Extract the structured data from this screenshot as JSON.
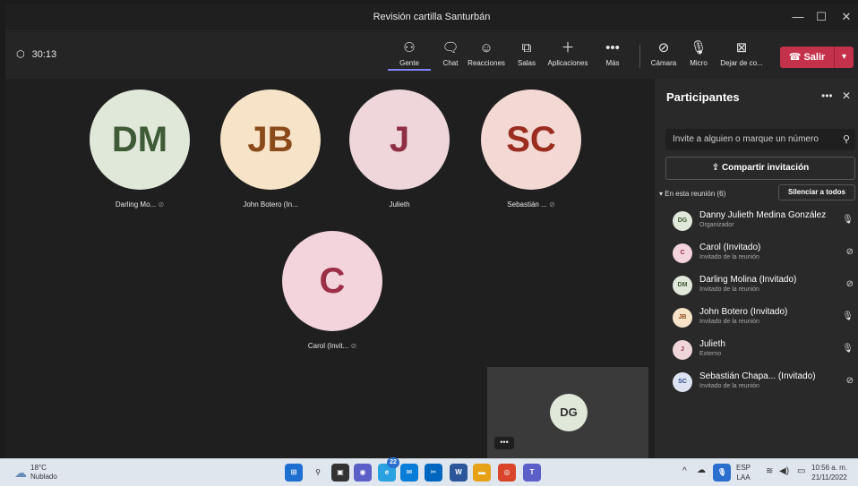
{
  "window": {
    "title": "Revisión cartilla Santurbán"
  },
  "toolbar": {
    "timer": "30:13",
    "buttons": [
      {
        "label": "Gente",
        "icon": "people-icon"
      },
      {
        "label": "Chat",
        "icon": "chat-icon"
      },
      {
        "label": "Reacciones",
        "icon": "reactions-icon"
      },
      {
        "label": "Salas",
        "icon": "rooms-icon"
      },
      {
        "label": "Aplicaciones",
        "icon": "apps-icon"
      },
      {
        "label": "Más",
        "icon": "more-icon"
      },
      {
        "label": "Cámara",
        "icon": "camera-off-icon"
      },
      {
        "label": "Micro",
        "icon": "mic-icon"
      },
      {
        "label": "Dejar de co...",
        "icon": "stop-share-icon"
      }
    ],
    "leave_label": "Salir"
  },
  "stage": {
    "tiles": [
      {
        "initials": "DM",
        "label": "Darling Mo...",
        "muted": true,
        "bg": "#dfe8d9",
        "fg": "#3f5a37"
      },
      {
        "initials": "JB",
        "label": "John Botero (In...",
        "muted": false,
        "bg": "#f7e3c8",
        "fg": "#8a4a1a"
      },
      {
        "initials": "J",
        "label": "Julieth",
        "muted": false,
        "bg": "#eed6da",
        "fg": "#8e2f44"
      },
      {
        "initials": "SC",
        "label": "Sebastián ...",
        "muted": true,
        "bg": "#f3d8d3",
        "fg": "#9a2d1f"
      },
      {
        "initials": "C",
        "label": "Carol (Invit...",
        "muted": true,
        "bg": "#f3d3dc",
        "fg": "#9b2f47"
      }
    ],
    "self_initials": "DG",
    "self_more": "•••"
  },
  "panel": {
    "title": "Participantes",
    "invite_placeholder": "Invite a alguien o marque un número",
    "share_label": "Compartir invitación",
    "section_label": "En esta reunión (6)",
    "mute_all_label": "Silenciar a todos",
    "participants": [
      {
        "initials": "DG",
        "name": "Danny Julieth Medina González",
        "role": "Organizador",
        "muted": false,
        "bg": "#dfe8d9",
        "fg": "#3f5a37"
      },
      {
        "initials": "C",
        "name": "Carol (Invitado)",
        "role": "Invitado de la reunión",
        "muted": true,
        "bg": "#f3d3dc",
        "fg": "#9b2f47"
      },
      {
        "initials": "DM",
        "name": "Darling Molina (Invitado)",
        "role": "Invitado de la reunión",
        "muted": true,
        "bg": "#dfe8d9",
        "fg": "#3f5a37"
      },
      {
        "initials": "JB",
        "name": "John Botero (Invitado)",
        "role": "Invitado de la reunión",
        "muted": false,
        "bg": "#f7e3c8",
        "fg": "#8a4a1a"
      },
      {
        "initials": "J",
        "name": "Julieth",
        "role": "Externo",
        "muted": false,
        "bg": "#eed6da",
        "fg": "#8e2f44"
      },
      {
        "initials": "SC",
        "name": "Sebastián Chapa... (Invitado)",
        "role": "Invitado de la reunión",
        "muted": true,
        "bg": "#dde3f0",
        "fg": "#2f4a8a"
      }
    ]
  },
  "taskbar": {
    "weather_temp": "18°C",
    "weather_desc": "Nublado",
    "language": "ESP",
    "language_sub": "LAA",
    "time": "10:56 a. m.",
    "date": "21/11/2022",
    "badge_count": "22"
  }
}
